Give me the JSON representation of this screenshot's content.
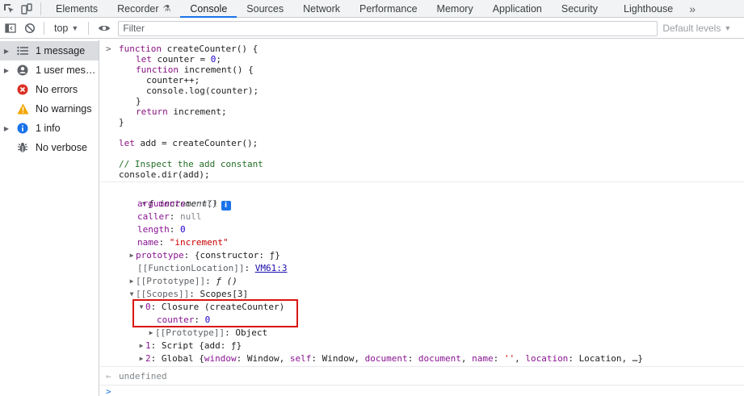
{
  "tabs": [
    {
      "label": "Elements",
      "active": false
    },
    {
      "label": "Recorder",
      "active": false
    },
    {
      "label": "Console",
      "active": true
    },
    {
      "label": "Sources",
      "active": false
    },
    {
      "label": "Network",
      "active": false
    },
    {
      "label": "Performance",
      "active": false
    },
    {
      "label": "Memory",
      "active": false
    },
    {
      "label": "Application",
      "active": false
    },
    {
      "label": "Security",
      "active": false
    },
    {
      "label": "Lighthouse",
      "active": false
    }
  ],
  "toolbar": {
    "context": "top",
    "filter_placeholder": "Filter",
    "levels": "Default levels"
  },
  "sidebar": {
    "items": [
      {
        "label": "1 message",
        "icon": "list-icon"
      },
      {
        "label": "1 user mes…",
        "icon": "user-icon"
      },
      {
        "label": "No errors",
        "icon": "error-icon"
      },
      {
        "label": "No warnings",
        "icon": "warning-icon"
      },
      {
        "label": "1 info",
        "icon": "info-icon"
      },
      {
        "label": "No verbose",
        "icon": "bug-icon"
      }
    ]
  },
  "code": {
    "line1_kw": "function",
    "line1_rest": " createCounter() {",
    "line2_kw": "let",
    "line2_mid": " counter = ",
    "line2_num": "0",
    "line2_end": ";",
    "line3_kw": "function",
    "line3_rest": " increment() {",
    "line4": "counter++;",
    "line5": "console.log(counter);",
    "line6": "}",
    "line7_kw": "return",
    "line7_rest": " increment;",
    "line8": "}",
    "line9_kw": "let",
    "line9_rest": " add = createCounter();",
    "line10_comment": "// Inspect the add constant",
    "line11": "console.dir(add);"
  },
  "tree": {
    "func_header": "ƒ increment()",
    "info_badge": "i",
    "arguments_key": "arguments",
    "arguments_val": "null",
    "caller_key": "caller",
    "caller_val": "null",
    "length_key": "length",
    "length_val": "0",
    "name_key": "name",
    "name_val": "\"increment\"",
    "prototype_key": "prototype",
    "prototype_val": "{constructor: ƒ}",
    "location_key": "[[FunctionLocation]]",
    "location_val": "VM61:3",
    "proto_key": "[[Prototype]]",
    "proto_val": "ƒ ()",
    "scopes_key": "[[Scopes]]",
    "scopes_val": "Scopes[3]",
    "scope0_key": "0",
    "scope0_val": "Closure (createCounter)",
    "counter_key": "counter",
    "counter_val": "0",
    "closure_proto_key": "[[Prototype]]",
    "closure_proto_val": "Object",
    "scope1_key": "1",
    "scope1_val": "Script {add: ƒ}",
    "scope2_key": "2",
    "scope2_val_a": "Global {",
    "g_window_k": "window",
    "g_window_v": "Window",
    "g_self_k": "self",
    "g_self_v": "Window",
    "g_doc_k": "document",
    "g_doc_v": "document",
    "g_name_k": "name",
    "g_name_v": "''",
    "g_loc_k": "location",
    "g_loc_v": "Location",
    "g_end": "…}"
  },
  "result": "undefined",
  "colors": {
    "accent": "#1a73e8",
    "highlight_border": "#d9140f",
    "keyword": "#881280",
    "number": "#1c00cf",
    "comment": "#236e25",
    "string": "#c80000"
  }
}
